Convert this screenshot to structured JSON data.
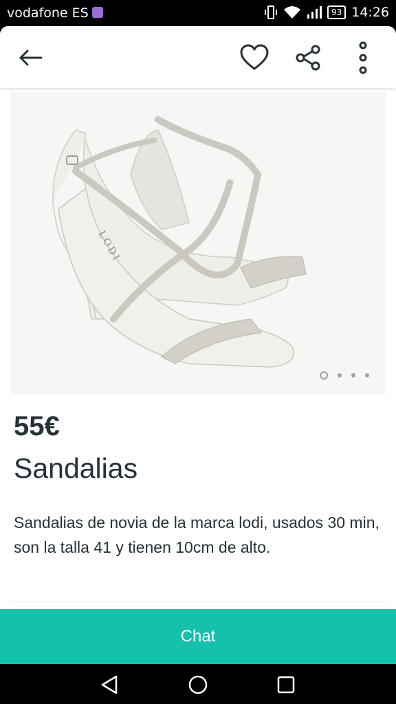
{
  "status_bar": {
    "carrier": "vodafone ES",
    "battery": "93",
    "time": "14:26",
    "icons": [
      "message-icon",
      "vibrate-icon",
      "wifi-icon",
      "signal-icon",
      "battery-icon"
    ]
  },
  "toolbar": {
    "icons": [
      "back-arrow-icon",
      "heart-icon",
      "share-icon",
      "more-vertical-icon"
    ]
  },
  "gallery": {
    "image_subject": "white bridal sandals with rhinestone straps, brand LODI",
    "brand_mark": "LODI",
    "image_count": 4,
    "active_index": 0
  },
  "product": {
    "price": "55€",
    "title": "Sandalias",
    "description": "Sandalias de novia de la marca lodi, usados 30 min, son la talla 41 y tienen 10cm de alto."
  },
  "actions": {
    "chat_label": "Chat"
  },
  "colors": {
    "accent": "#13c1ac",
    "text": "#253238"
  },
  "nav_bar": {
    "icons": [
      "nav-back-icon",
      "nav-home-icon",
      "nav-recent-icon"
    ]
  }
}
